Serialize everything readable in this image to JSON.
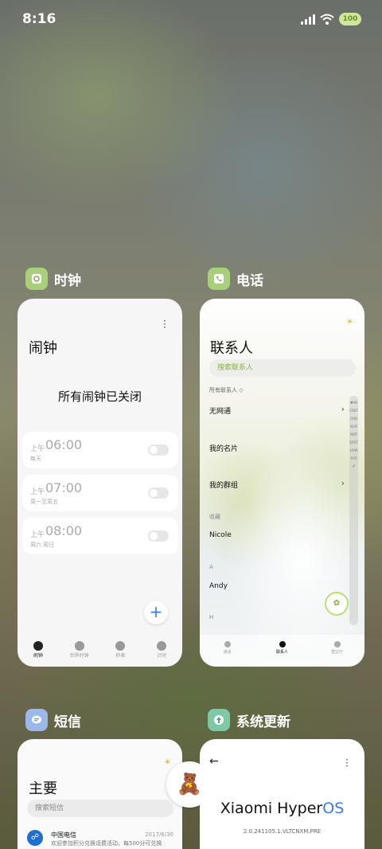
{
  "status_bar": {
    "time": "8:16",
    "battery": "100"
  },
  "apps": {
    "clock": {
      "label": "时钟",
      "icon": "clock-app-icon",
      "icon_color": "#a8d07a"
    },
    "phone": {
      "label": "电话",
      "icon": "phone-app-icon",
      "icon_color": "#a8d07a"
    },
    "messages": {
      "label": "短信",
      "icon": "messages-app-icon",
      "icon_color": "#9ab8e8"
    },
    "updater": {
      "label": "系统更新",
      "icon": "updater-app-icon",
      "icon_color": "#7ec8a8"
    }
  },
  "clock_card": {
    "title": "闹钟",
    "message": "所有闹钟已关闭",
    "alarms": [
      {
        "ampm": "上午",
        "time": "06:00",
        "repeat": "每天",
        "enabled": false
      },
      {
        "ampm": "上午",
        "time": "07:00",
        "repeat": "周一至周五",
        "enabled": false
      },
      {
        "ampm": "上午",
        "time": "08:00",
        "repeat": "周六 周日",
        "enabled": false
      }
    ],
    "add_label": "+",
    "tabs": [
      "闹钟",
      "世界时钟",
      "秒表",
      "计时"
    ],
    "active_tab": 0
  },
  "phone_card": {
    "title": "联系人",
    "search_placeholder": "搜索联系人",
    "filter_label": "所有联系人 ◇",
    "rows": [
      {
        "label": "无网通",
        "chevron": "›"
      },
      {
        "label": "我的名片",
        "chevron": ""
      },
      {
        "label": "我的群组",
        "chevron": "›"
      }
    ],
    "favorites_header": "收藏",
    "favorite_contact": "Nicole",
    "section_a": "A",
    "contact_a": "Andy",
    "section_next": "H",
    "index_letters": "♥ABCDEFGHIJKLMNOPQRSTUVWXYZ#",
    "tabs": [
      "通话",
      "联系人",
      "营业厅"
    ],
    "active_tab": 1
  },
  "messages_card": {
    "title": "主要",
    "search_placeholder": "搜索短信",
    "thread": {
      "name": "中国电信",
      "date": "2017/6/30",
      "preview": "欢迎参加积分兑换话费活动，每500分可兑换"
    }
  },
  "updater_card": {
    "back_label": "←",
    "brand": "Xiaomi Hyper",
    "brand_os": "OS",
    "version": "2.0.241105.1.VLTCNXM.PRE"
  }
}
